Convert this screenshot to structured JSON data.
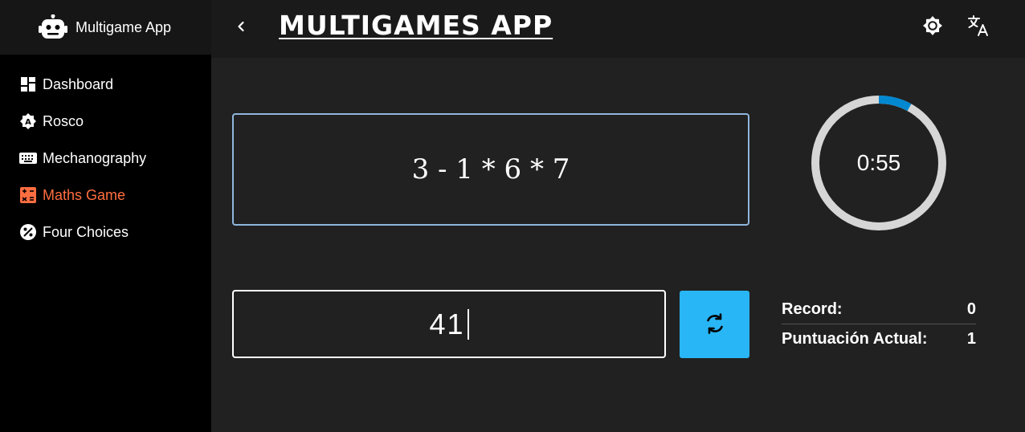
{
  "app": {
    "name": "Multigame App"
  },
  "sidebar": {
    "items": [
      {
        "label": "Dashboard",
        "icon": "dashboard-icon",
        "active": false
      },
      {
        "label": "Rosco",
        "icon": "rosco-icon",
        "active": false
      },
      {
        "label": "Mechanography",
        "icon": "keyboard-icon",
        "active": false
      },
      {
        "label": "Maths Game",
        "icon": "calculator-icon",
        "active": true
      },
      {
        "label": "Four Choices",
        "icon": "quiz-icon",
        "active": false
      }
    ]
  },
  "header": {
    "title": "MULTIGAMES APP",
    "icons": [
      "back-arrow-icon",
      "brightness-icon",
      "translate-icon"
    ]
  },
  "game": {
    "expression": "3 - 1 * 6 * 7",
    "answer": "41",
    "timer": {
      "text": "0:55",
      "progress_fraction": 0.08
    },
    "scores": [
      {
        "label": "Record:",
        "value": "0"
      },
      {
        "label": "Puntuación Actual:",
        "value": "1"
      }
    ]
  },
  "colors": {
    "accent_active": "#ff6e40",
    "button_blue": "#29b6f6",
    "timer_arc": "#0288d1",
    "timer_track": "#d6d6d6",
    "expression_border": "#8fb6dd"
  }
}
